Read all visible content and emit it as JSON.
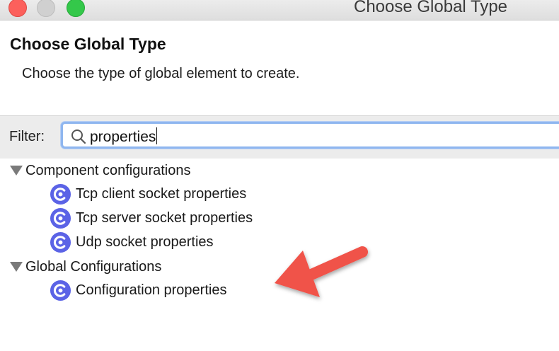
{
  "window": {
    "title": "Choose Global Type",
    "traffic_lights": {
      "close": "#fc605c",
      "minimize": "#d0d0d0",
      "maximize": "#34c84a"
    }
  },
  "dialog": {
    "title": "Choose Global Type",
    "description": "Choose the type of global element to create."
  },
  "filter": {
    "label": "Filter:",
    "value": "properties",
    "icon": "search-icon"
  },
  "tree": {
    "groups": [
      {
        "label": "Component configurations",
        "expanded": true,
        "items": [
          {
            "label": "Tcp client socket properties",
            "icon": "config-c-icon"
          },
          {
            "label": "Tcp server socket properties",
            "icon": "config-c-icon"
          },
          {
            "label": "Udp socket properties",
            "icon": "config-c-icon"
          }
        ]
      },
      {
        "label": "Global Configurations",
        "expanded": true,
        "items": [
          {
            "label": "Configuration properties",
            "icon": "config-c-icon"
          }
        ]
      }
    ]
  },
  "annotation": {
    "color": "#f0524a",
    "points_to": "Configuration properties"
  },
  "colors": {
    "icon_blue": "#5b63e6",
    "focus_ring": "#8fb6ef"
  }
}
